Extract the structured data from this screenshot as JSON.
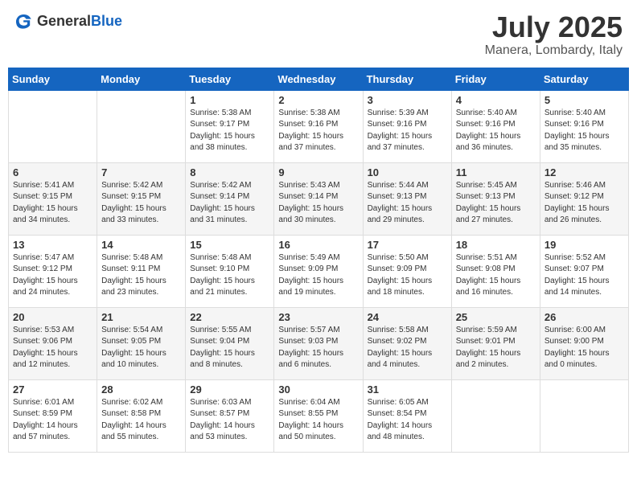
{
  "header": {
    "logo_general": "General",
    "logo_blue": "Blue",
    "month_title": "July 2025",
    "location": "Manera, Lombardy, Italy"
  },
  "weekdays": [
    "Sunday",
    "Monday",
    "Tuesday",
    "Wednesday",
    "Thursday",
    "Friday",
    "Saturday"
  ],
  "weeks": [
    [
      {
        "day": "",
        "info": ""
      },
      {
        "day": "",
        "info": ""
      },
      {
        "day": "1",
        "info": "Sunrise: 5:38 AM\nSunset: 9:17 PM\nDaylight: 15 hours and 38 minutes."
      },
      {
        "day": "2",
        "info": "Sunrise: 5:38 AM\nSunset: 9:16 PM\nDaylight: 15 hours and 37 minutes."
      },
      {
        "day": "3",
        "info": "Sunrise: 5:39 AM\nSunset: 9:16 PM\nDaylight: 15 hours and 37 minutes."
      },
      {
        "day": "4",
        "info": "Sunrise: 5:40 AM\nSunset: 9:16 PM\nDaylight: 15 hours and 36 minutes."
      },
      {
        "day": "5",
        "info": "Sunrise: 5:40 AM\nSunset: 9:16 PM\nDaylight: 15 hours and 35 minutes."
      }
    ],
    [
      {
        "day": "6",
        "info": "Sunrise: 5:41 AM\nSunset: 9:15 PM\nDaylight: 15 hours and 34 minutes."
      },
      {
        "day": "7",
        "info": "Sunrise: 5:42 AM\nSunset: 9:15 PM\nDaylight: 15 hours and 33 minutes."
      },
      {
        "day": "8",
        "info": "Sunrise: 5:42 AM\nSunset: 9:14 PM\nDaylight: 15 hours and 31 minutes."
      },
      {
        "day": "9",
        "info": "Sunrise: 5:43 AM\nSunset: 9:14 PM\nDaylight: 15 hours and 30 minutes."
      },
      {
        "day": "10",
        "info": "Sunrise: 5:44 AM\nSunset: 9:13 PM\nDaylight: 15 hours and 29 minutes."
      },
      {
        "day": "11",
        "info": "Sunrise: 5:45 AM\nSunset: 9:13 PM\nDaylight: 15 hours and 27 minutes."
      },
      {
        "day": "12",
        "info": "Sunrise: 5:46 AM\nSunset: 9:12 PM\nDaylight: 15 hours and 26 minutes."
      }
    ],
    [
      {
        "day": "13",
        "info": "Sunrise: 5:47 AM\nSunset: 9:12 PM\nDaylight: 15 hours and 24 minutes."
      },
      {
        "day": "14",
        "info": "Sunrise: 5:48 AM\nSunset: 9:11 PM\nDaylight: 15 hours and 23 minutes."
      },
      {
        "day": "15",
        "info": "Sunrise: 5:48 AM\nSunset: 9:10 PM\nDaylight: 15 hours and 21 minutes."
      },
      {
        "day": "16",
        "info": "Sunrise: 5:49 AM\nSunset: 9:09 PM\nDaylight: 15 hours and 19 minutes."
      },
      {
        "day": "17",
        "info": "Sunrise: 5:50 AM\nSunset: 9:09 PM\nDaylight: 15 hours and 18 minutes."
      },
      {
        "day": "18",
        "info": "Sunrise: 5:51 AM\nSunset: 9:08 PM\nDaylight: 15 hours and 16 minutes."
      },
      {
        "day": "19",
        "info": "Sunrise: 5:52 AM\nSunset: 9:07 PM\nDaylight: 15 hours and 14 minutes."
      }
    ],
    [
      {
        "day": "20",
        "info": "Sunrise: 5:53 AM\nSunset: 9:06 PM\nDaylight: 15 hours and 12 minutes."
      },
      {
        "day": "21",
        "info": "Sunrise: 5:54 AM\nSunset: 9:05 PM\nDaylight: 15 hours and 10 minutes."
      },
      {
        "day": "22",
        "info": "Sunrise: 5:55 AM\nSunset: 9:04 PM\nDaylight: 15 hours and 8 minutes."
      },
      {
        "day": "23",
        "info": "Sunrise: 5:57 AM\nSunset: 9:03 PM\nDaylight: 15 hours and 6 minutes."
      },
      {
        "day": "24",
        "info": "Sunrise: 5:58 AM\nSunset: 9:02 PM\nDaylight: 15 hours and 4 minutes."
      },
      {
        "day": "25",
        "info": "Sunrise: 5:59 AM\nSunset: 9:01 PM\nDaylight: 15 hours and 2 minutes."
      },
      {
        "day": "26",
        "info": "Sunrise: 6:00 AM\nSunset: 9:00 PM\nDaylight: 15 hours and 0 minutes."
      }
    ],
    [
      {
        "day": "27",
        "info": "Sunrise: 6:01 AM\nSunset: 8:59 PM\nDaylight: 14 hours and 57 minutes."
      },
      {
        "day": "28",
        "info": "Sunrise: 6:02 AM\nSunset: 8:58 PM\nDaylight: 14 hours and 55 minutes."
      },
      {
        "day": "29",
        "info": "Sunrise: 6:03 AM\nSunset: 8:57 PM\nDaylight: 14 hours and 53 minutes."
      },
      {
        "day": "30",
        "info": "Sunrise: 6:04 AM\nSunset: 8:55 PM\nDaylight: 14 hours and 50 minutes."
      },
      {
        "day": "31",
        "info": "Sunrise: 6:05 AM\nSunset: 8:54 PM\nDaylight: 14 hours and 48 minutes."
      },
      {
        "day": "",
        "info": ""
      },
      {
        "day": "",
        "info": ""
      }
    ]
  ]
}
